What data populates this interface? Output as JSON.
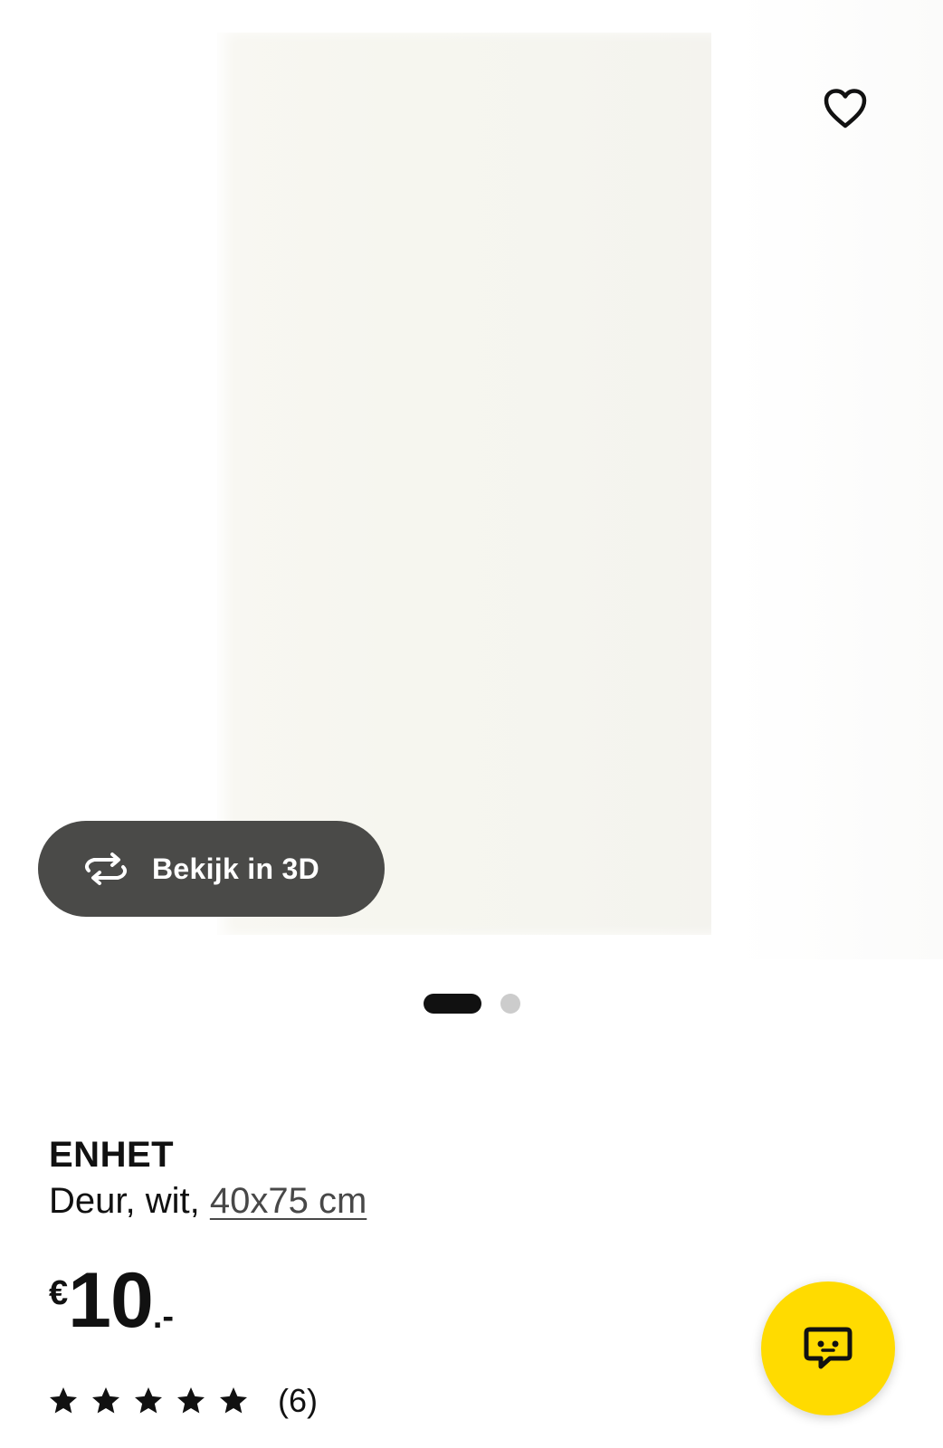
{
  "gallery": {
    "view3d_label": "Bekijk in 3D",
    "favorite_icon": "heart-icon",
    "pager": {
      "total": 2,
      "active": 1
    }
  },
  "product": {
    "name": "ENHET",
    "description_prefix": "Deur, wit, ",
    "size": "40x75 cm"
  },
  "price": {
    "currency": "€",
    "integer": "10",
    "decimal": ".-"
  },
  "rating": {
    "stars": 5,
    "max": 5,
    "count": "(6)"
  },
  "chat": {
    "icon": "chat-bubble-icon",
    "color": "#ffdb00"
  }
}
